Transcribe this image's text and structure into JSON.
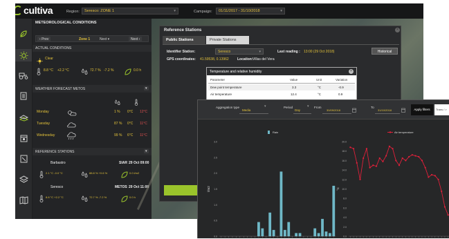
{
  "app": {
    "brand": "cultiva"
  },
  "topbar": {
    "region_label": "Region:",
    "region_value": "Seresco: ZONE 1",
    "campaign_label": "Campaign:",
    "campaign_value": "01/11/2017 - 31/10/2018"
  },
  "left": {
    "title": "METEOROLOGICAL CONDITIONS",
    "prev": "Prev",
    "zone": "Zone 1",
    "next_select": "Next",
    "next": "Next",
    "actual_title": "ACTUAL CONDITIONS",
    "clear": "Clear",
    "temp": "8.8 °C",
    "temp_delta": "+2.2 °C",
    "humidity": "72.7 %",
    "humidity_delta": "-7.2 %",
    "rain": "0.0 h",
    "forecast_title": "WEATHER FORECAST METOS",
    "forecast": [
      {
        "day": "Monday",
        "hum": "1 %",
        "min": "0°C",
        "max": "12°C"
      },
      {
        "day": "Tuesday",
        "hum": "87 %",
        "min": "0°C",
        "max": "11°C"
      },
      {
        "day": "Wednesday",
        "hum": "99 %",
        "min": "6°C",
        "max": "11°C"
      }
    ],
    "stations_title": "REFERENCE STATIONS",
    "stations": [
      {
        "name": "Barbastro",
        "source": "SIAR",
        "date": "29 Oct 09:00",
        "t": "2.1 °C -0.0 °C",
        "h": "88.8 % +0.6 %",
        "r": "0.0 l/m2"
      },
      {
        "name": "Seresco",
        "source": "METOS",
        "date": "29 Oct 11:00",
        "t": "8.8 °C +2.2 °C",
        "h": "72.7 % -7.2 %",
        "r": "0.0 h"
      }
    ]
  },
  "ref": {
    "title": "Reference Stations",
    "tab_public": "Public Stations",
    "tab_private": "Private Stations",
    "id_label": "Identifier Station:",
    "id_value": "Seresco",
    "last_label": "Last reading :",
    "last_value": "13:00 (29 Oct 2018)",
    "historical": "Historical",
    "gps_label": "GPS coordinates:",
    "gps_value": "41.59538, 0.13962",
    "loc_label": "Location:",
    "loc_value": "Villas del Vera"
  },
  "popup": {
    "title": "Temperature and relative humidity",
    "headers": [
      "Parameter",
      "Value",
      "Unit",
      "Variation"
    ],
    "rows": [
      [
        "Dew point temperature",
        "3.3",
        "°C",
        "-0.9"
      ],
      [
        "Air temperature",
        "12.4",
        "°C",
        "0.9"
      ]
    ]
  },
  "chart": {
    "agg_label": "Aggregation type",
    "agg_value": "Media",
    "period_label": "Period",
    "period_value": "Day",
    "from_label": "From",
    "from_value": "30/09/2018",
    "to_label": "To",
    "to_value": "31/10/2018",
    "apply": "Apply filters",
    "export": "Trans / >"
  },
  "chart_data": [
    {
      "type": "bar",
      "title": "Rain",
      "ylabel": "l/m2",
      "ylim": [
        0,
        3.0
      ],
      "yticks": [
        "3.0",
        "2.5",
        "2.0",
        "1.5",
        "1.0",
        "0.5",
        "0.0"
      ],
      "series": [
        {
          "name": "Rain",
          "values": [
            0,
            0,
            0,
            0,
            0,
            0,
            0,
            0,
            0,
            0,
            0.45,
            0.25,
            0,
            0.75,
            0.2,
            0,
            2.05,
            0.2,
            0.45,
            0,
            0.1,
            0.1,
            0,
            0,
            0,
            0.25,
            0.1,
            0.55,
            0.15,
            0.1,
            1.6
          ]
        }
      ],
      "color": "#6fb8c7"
    },
    {
      "type": "line",
      "title": "Air temperature",
      "ylabel": "°C",
      "ylim": [
        0,
        20.0
      ],
      "yticks": [
        "20.0",
        "18.0",
        "16.0",
        "14.0",
        "12.0",
        "10.0",
        "8.0",
        "6.0",
        "4.0",
        "2.0",
        "0.0"
      ],
      "series": [
        {
          "name": "Air temperature",
          "values": [
            18.8,
            18.5,
            15.5,
            12,
            16.5,
            18.5,
            14.5,
            15,
            14.8,
            16.5,
            15.8,
            17,
            19,
            18.5,
            16,
            15,
            16.5,
            16,
            16.8,
            17.2,
            17,
            16.8,
            16,
            14.5,
            12.5,
            13,
            12.8,
            12,
            9.5,
            6.2,
            4.5
          ]
        }
      ],
      "color": "#e0203a"
    }
  ]
}
